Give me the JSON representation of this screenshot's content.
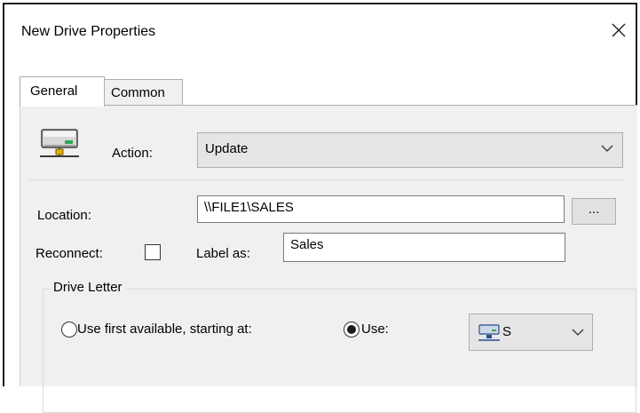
{
  "window": {
    "title": "New Drive Properties",
    "close_glyph": "✕"
  },
  "tabs": [
    {
      "label": "General",
      "active": true
    },
    {
      "label": "Common",
      "active": false
    }
  ],
  "general": {
    "action_label": "Action:",
    "action_value": "Update",
    "location_label": "Location:",
    "location_value": "\\\\FILE1\\SALES",
    "browse_label": "...",
    "reconnect_label": "Reconnect:",
    "reconnect_checked": false,
    "label_as_label": "Label as:",
    "label_as_value": "Sales",
    "drive_letter_group": "Drive Letter",
    "use_first_label": "Use first available, starting at:",
    "use_label": "Use:",
    "selected_option": "use",
    "drive_letter_value": "S"
  },
  "icons": {
    "drive": "network-drive-icon",
    "dropdown": "chevron-down-icon",
    "close": "close-icon"
  },
  "colors": {
    "panel_bg": "#f0f0f0",
    "combo_bg": "#e5e5e5",
    "border": "#adadad",
    "window_border": "#1a1a1a"
  }
}
